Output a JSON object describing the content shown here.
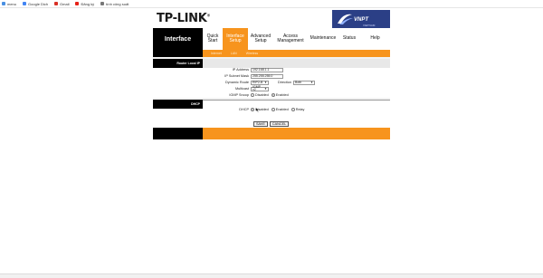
{
  "bookmarks": [
    {
      "label": "menu",
      "color": "#4a90e2"
    },
    {
      "label": "Google Dich",
      "color": "#4285f4"
    },
    {
      "label": "Gmail",
      "color": "#d93025"
    },
    {
      "label": "Đăng ký",
      "color": "#e62117"
    },
    {
      "label": "tính công suất",
      "color": "#777777"
    }
  ],
  "brand": {
    "logo": "TP-LINK",
    "logo_mark": "®",
    "isp": "VNPT",
    "isp_sub": "VIETNAM"
  },
  "nav": {
    "title": "Interface",
    "items": [
      {
        "label": "Quick Start"
      },
      {
        "label": "Interface Setup",
        "active": true
      },
      {
        "label": "Advanced Setup"
      },
      {
        "label": "Access Management"
      },
      {
        "label": "Maintenance"
      },
      {
        "label": "Status"
      },
      {
        "label": "Help"
      }
    ],
    "subtabs": [
      "Internet",
      "LAN",
      "Wireless"
    ]
  },
  "sections": {
    "router_local_ip": "Router Local IP",
    "dhcp": "DHCP"
  },
  "form": {
    "ip_address": {
      "label": "IP Address",
      "value": "192.168.1.1"
    },
    "subnet_mask": {
      "label": "IP Subnet Mask",
      "value": "255.255.255.0"
    },
    "dynamic_route": {
      "label": "Dynamic Route",
      "value": "RIP2-B"
    },
    "direction": {
      "label": "Direction",
      "value": "Both"
    },
    "multicast": {
      "label": "Multicast",
      "value": "IGMP v2"
    },
    "igmp_snoop": {
      "label": "IGMP Snoop",
      "options": [
        "Disabled",
        "Enabled"
      ],
      "selected": "Enabled"
    },
    "dhcp": {
      "label": "DHCP",
      "options": [
        "Disabled",
        "Enabled",
        "Relay"
      ],
      "selected": "Disabled"
    }
  },
  "buttons": {
    "save": "SAVE",
    "cancel": "CANCEL"
  },
  "colors": {
    "accent": "#f7941d",
    "nav_black": "#000000",
    "isp_blue": "#2b3f86"
  }
}
